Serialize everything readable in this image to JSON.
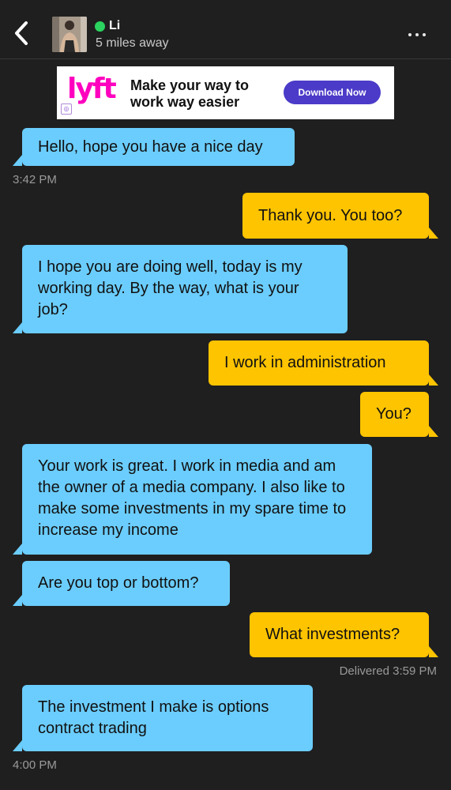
{
  "header": {
    "name": "Li",
    "distance": "5 miles away",
    "online_color": "#2bd25f",
    "back_icon": "chevron-left-icon",
    "more_icon": "more-horizontal-icon"
  },
  "ad": {
    "brand": "lyft",
    "headline": "Make your way to work way easier",
    "cta": "Download Now",
    "brand_color": "#ff00bf",
    "cta_color": "#4b3bc8"
  },
  "colors": {
    "background": "#1f1f1f",
    "incoming_bubble": "#6bcdfd",
    "outgoing_bubble": "#ffc400",
    "meta_text": "#9a9a9a"
  },
  "messages": [
    {
      "direction": "in",
      "text": "Hello, hope you have a nice day"
    },
    {
      "direction": "out",
      "text": "Thank you. You too?"
    },
    {
      "direction": "in",
      "text": "I hope you are doing well, today is my working day. By the way, what is your job?"
    },
    {
      "direction": "out",
      "text": "I work in administration"
    },
    {
      "direction": "out",
      "text": "You?"
    },
    {
      "direction": "in",
      "text": "Your work is great. I work in media and am the owner of a media company. I also like to make some investments in my spare time to increase my income"
    },
    {
      "direction": "in",
      "text": "Are you top or bottom?"
    },
    {
      "direction": "out",
      "text": "What investments?"
    },
    {
      "direction": "in",
      "text": "The investment I make is options contract trading"
    }
  ],
  "timestamps": {
    "t1": "3:42 PM",
    "delivered": "Delivered 3:59 PM",
    "t3": "4:00 PM"
  }
}
